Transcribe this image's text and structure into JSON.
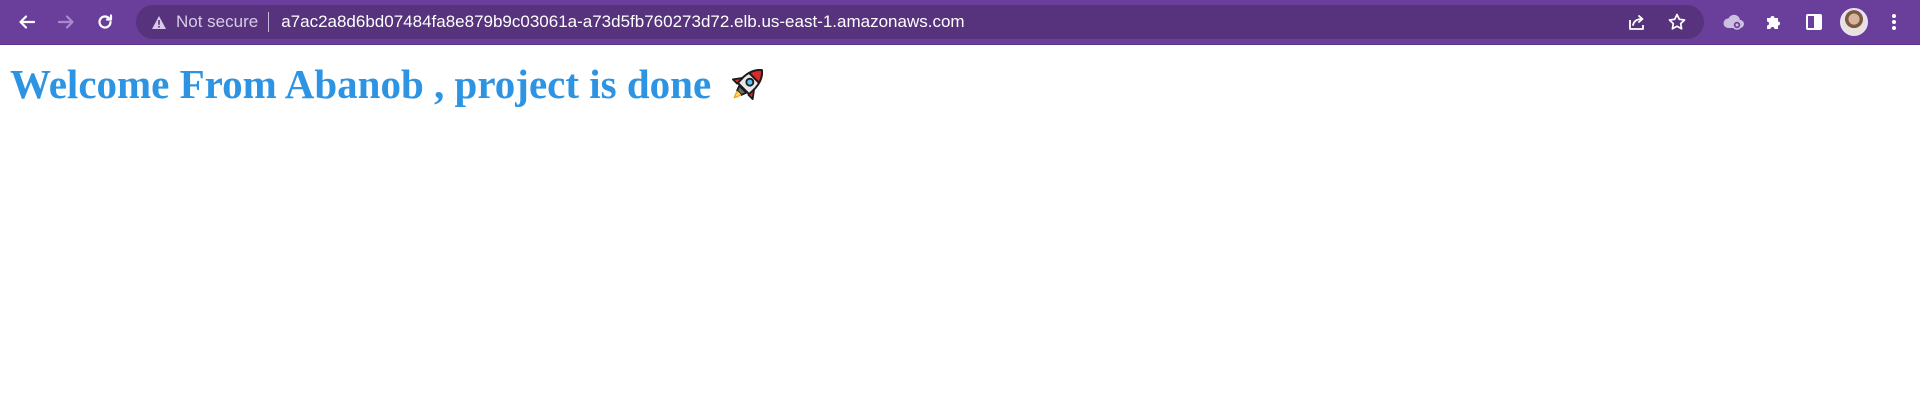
{
  "browser": {
    "security_label": "Not secure",
    "url": "a7ac2a8d6bd07484fa8e879b9c03061a-a73d5fb760273d72.elb.us-east-1.amazonaws.com",
    "toolbar_color": "#6a3f9c",
    "omnibox_color": "#56337c",
    "icons": {
      "back": "arrow-left-icon",
      "forward": "arrow-right-icon",
      "reload": "reload-icon",
      "warning": "warning-icon",
      "share": "share-icon",
      "bookmark": "star-icon",
      "cloud": "cloud-icon",
      "extensions": "puzzle-icon",
      "side_panel": "side-panel-icon",
      "menu": "kebab-menu-icon"
    }
  },
  "page": {
    "heading": "Welcome From Abanob , project is done",
    "heading_color": "#2d94e4",
    "emoji": "rocket-icon"
  }
}
